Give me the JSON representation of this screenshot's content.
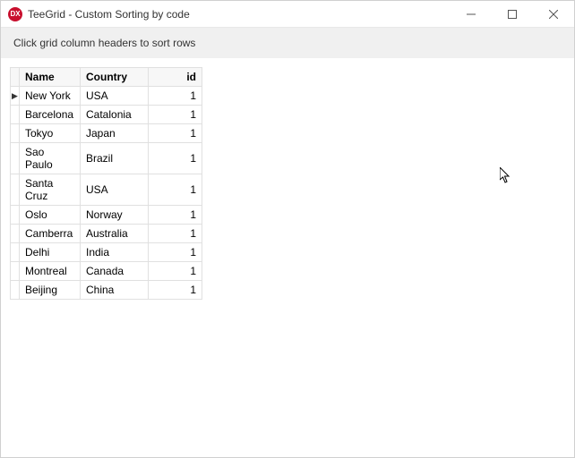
{
  "window": {
    "title": "TeeGrid - Custom Sorting by code",
    "icon_label": "DX"
  },
  "instruction": "Click grid column headers to sort rows",
  "grid": {
    "columns": {
      "name": "Name",
      "country": "Country",
      "id": "id"
    },
    "rows": [
      {
        "indicator": "▶",
        "name": "New York",
        "country": "USA",
        "id": "1"
      },
      {
        "indicator": "",
        "name": "Barcelona",
        "country": "Catalonia",
        "id": "1"
      },
      {
        "indicator": "",
        "name": "Tokyo",
        "country": "Japan",
        "id": "1"
      },
      {
        "indicator": "",
        "name": "Sao Paulo",
        "country": "Brazil",
        "id": "1"
      },
      {
        "indicator": "",
        "name": "Santa Cruz",
        "country": "USA",
        "id": "1"
      },
      {
        "indicator": "",
        "name": "Oslo",
        "country": "Norway",
        "id": "1"
      },
      {
        "indicator": "",
        "name": "Camberra",
        "country": "Australia",
        "id": "1"
      },
      {
        "indicator": "",
        "name": "Delhi",
        "country": "India",
        "id": "1"
      },
      {
        "indicator": "",
        "name": "Montreal",
        "country": "Canada",
        "id": "1"
      },
      {
        "indicator": "",
        "name": "Beijing",
        "country": "China",
        "id": "1"
      }
    ]
  }
}
